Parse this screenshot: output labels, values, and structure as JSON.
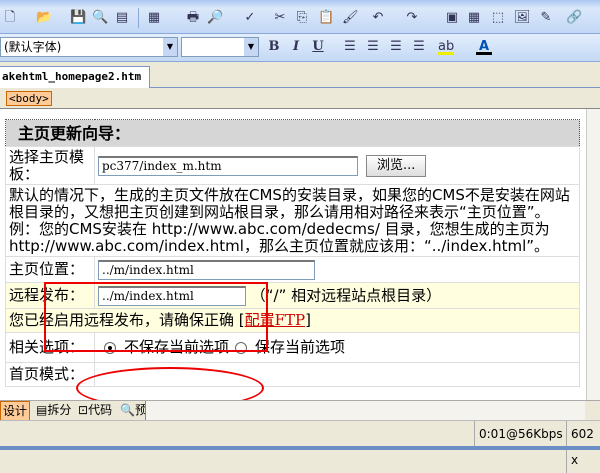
{
  "toolbar": {
    "font_name": "(默认字体)",
    "font_size": "",
    "bold": "B",
    "italic": "I",
    "underline": "U"
  },
  "document_tab": "akehtml_homepage2.htm",
  "tag_selector": "<body>",
  "form": {
    "title": "主页更新向导：",
    "template_label": "选择主页模板：",
    "template_value": "pc377/index_m.htm",
    "browse_button": "浏览...",
    "description": "默认的情况下，生成的主页文件放在CMS的安装目录，如果您的CMS不是安装在网站根目录的，又想把主页创建到网站根目录，那么请用相对路径来表示“主页位置”。",
    "example_line1": "例：您的CMS安装在 http://www.abc.com/dedecms/ 目录，您想生成的主页为 http://www.abc.com/index.html，那么主页位置就应该用：“../index.html”。",
    "location_label": "主页位置：",
    "location_value": "../m/index.html",
    "remote_label": "远程发布：",
    "remote_value": "../m/index.html",
    "remote_hint": "（“/” 相对远程站点根目录）",
    "ftp_notice": "您已经启用远程发布，请确保正确 [",
    "ftp_link": "配置FTP",
    "ftp_close": "]",
    "options_label": "相关选项：",
    "option_no_save": "不保存当前选项",
    "option_save": "保存当前选项",
    "partial_row": "首页模式："
  },
  "view_tabs": [
    "设计",
    "拆分",
    "代码",
    "预览"
  ],
  "status": {
    "download": "0:01@56Kbps",
    "size": "602 x"
  }
}
